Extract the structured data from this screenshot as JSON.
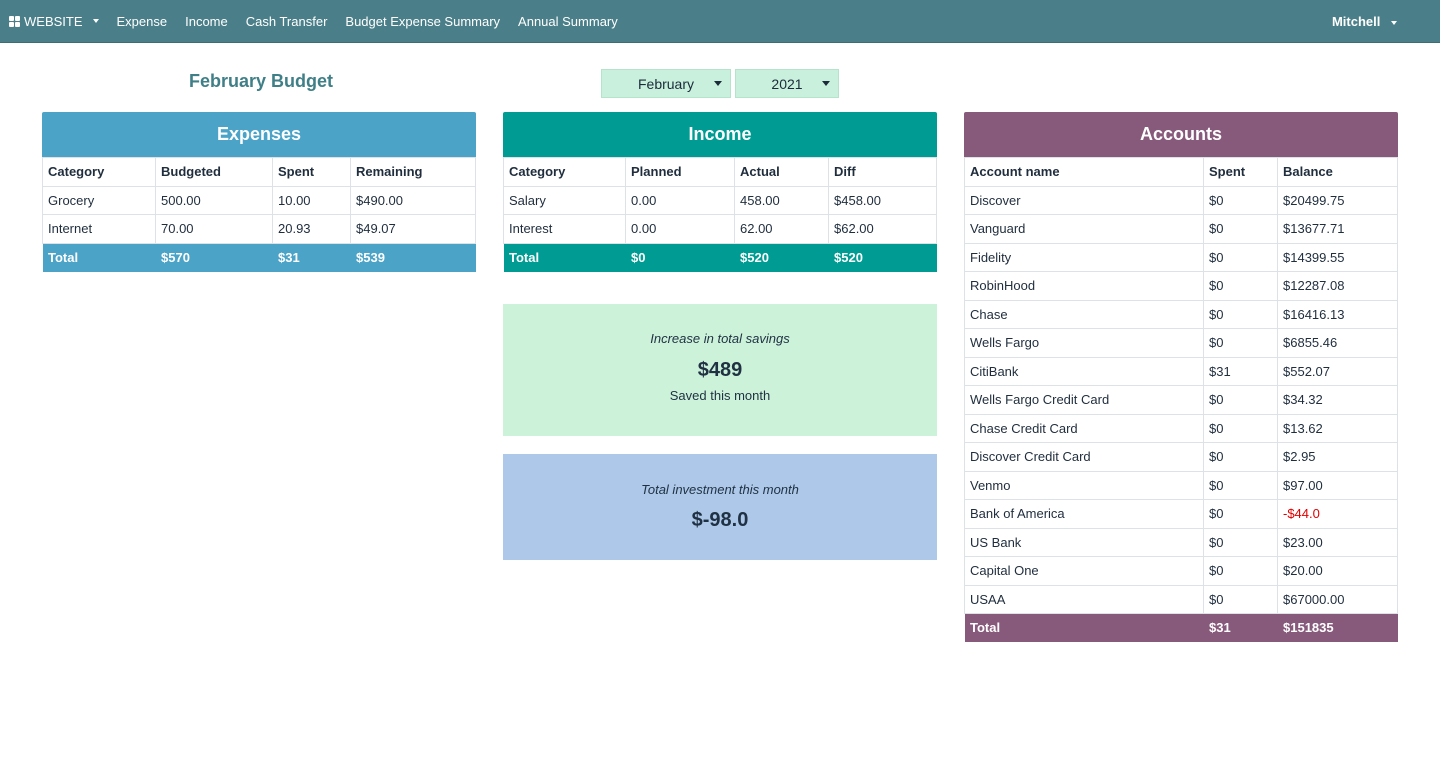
{
  "navbar": {
    "brand": "WEBSITE",
    "links": [
      "Expense",
      "Income",
      "Cash Transfer",
      "Budget Expense Summary",
      "Annual Summary"
    ],
    "user": "Mitchell",
    "bg_color": "#4a7f8a"
  },
  "page": {
    "title": "February Budget",
    "month_select": "February",
    "year_select": "2021"
  },
  "expenses": {
    "title": "Expenses",
    "color": "#4ba3c7",
    "columns": [
      "Category",
      "Budgeted",
      "Spent",
      "Remaining"
    ],
    "rows": [
      [
        "Grocery",
        "500.00",
        "10.00",
        "$490.00"
      ],
      [
        "Internet",
        "70.00",
        "20.93",
        "$49.07"
      ]
    ],
    "total": [
      "Total",
      "$570",
      "$31",
      "$539"
    ]
  },
  "income": {
    "title": "Income",
    "color": "#009c93",
    "columns": [
      "Category",
      "Planned",
      "Actual",
      "Diff"
    ],
    "rows": [
      [
        "Salary",
        "0.00",
        "458.00",
        "$458.00"
      ],
      [
        "Interest",
        "0.00",
        "62.00",
        "$62.00"
      ]
    ],
    "total": [
      "Total",
      "$0",
      "$520",
      "$520"
    ]
  },
  "savings": {
    "label": "Increase in total savings",
    "amount": "$489",
    "sub": "Saved this month",
    "color": "#cdf2da"
  },
  "investment": {
    "label": "Total investment this month",
    "amount": "$-98.0",
    "color": "#adc8e8"
  },
  "accounts": {
    "title": "Accounts",
    "color": "#875a7b",
    "columns": [
      "Account name",
      "Spent",
      "Balance"
    ],
    "rows": [
      [
        "Discover",
        "$0",
        "$20499.75"
      ],
      [
        "Vanguard",
        "$0",
        "$13677.71"
      ],
      [
        "Fidelity",
        "$0",
        "$14399.55"
      ],
      [
        "RobinHood",
        "$0",
        "$12287.08"
      ],
      [
        "Chase",
        "$0",
        "$16416.13"
      ],
      [
        "Wells Fargo",
        "$0",
        "$6855.46"
      ],
      [
        "CitiBank",
        "$31",
        "$552.07"
      ],
      [
        "Wells Fargo Credit Card",
        "$0",
        "$34.32"
      ],
      [
        "Chase Credit Card",
        "$0",
        "$13.62"
      ],
      [
        "Discover Credit Card",
        "$0",
        "$2.95"
      ],
      [
        "Venmo",
        "$0",
        "$97.00"
      ],
      [
        "Bank of America",
        "$0",
        "-$44.0"
      ],
      [
        "US Bank",
        "$0",
        "$23.00"
      ],
      [
        "Capital One",
        "$0",
        "$20.00"
      ],
      [
        "USAA",
        "$0",
        "$67000.00"
      ]
    ],
    "negative_color": "#e00000",
    "total": [
      "Total",
      "$31",
      "$151835"
    ]
  }
}
